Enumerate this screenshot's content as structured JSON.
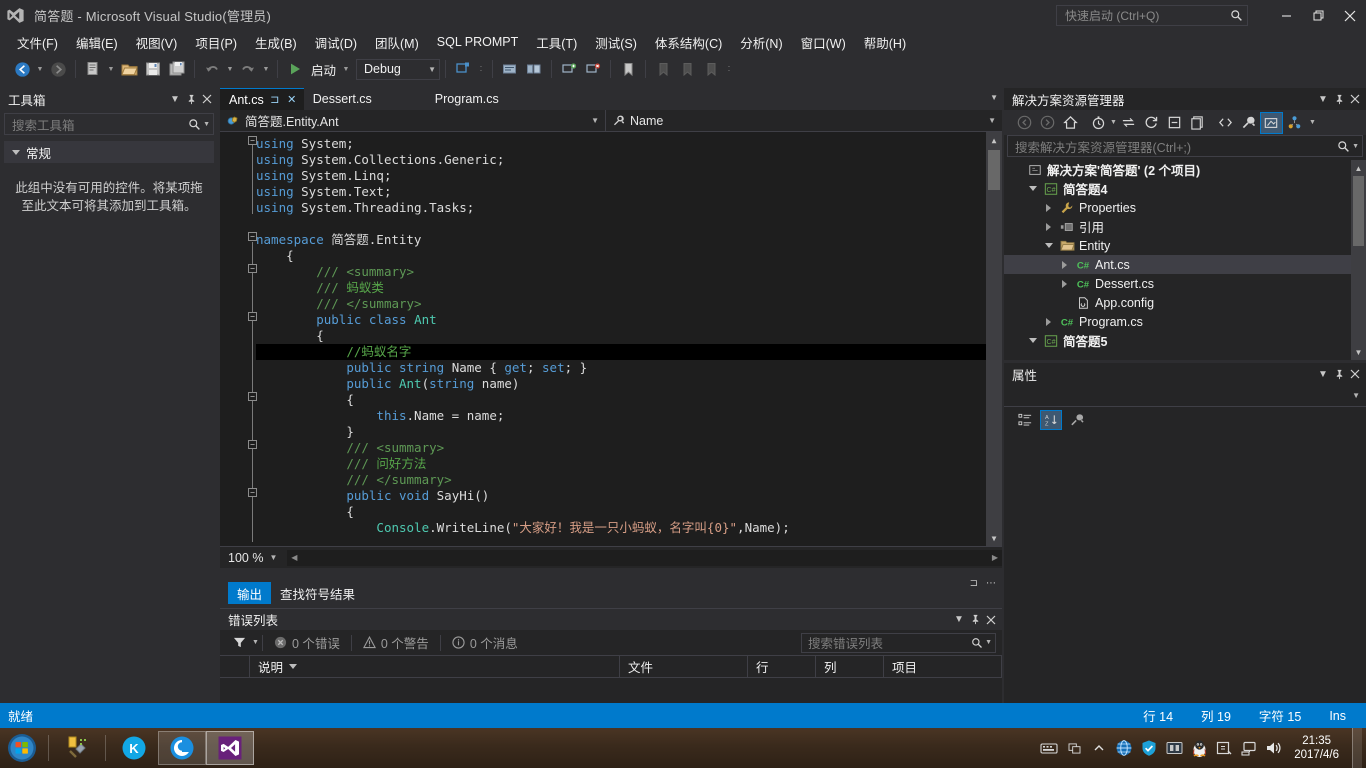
{
  "titlebar": {
    "title": "简答题 - Microsoft Visual Studio(管理员)",
    "quick_launch_placeholder": "快速启动 (Ctrl+Q)",
    "minimize": "—",
    "restore": "❐",
    "close": "✕"
  },
  "menu": {
    "items": [
      {
        "label": "文件(F)"
      },
      {
        "label": "编辑(E)"
      },
      {
        "label": "视图(V)"
      },
      {
        "label": "项目(P)"
      },
      {
        "label": "生成(B)"
      },
      {
        "label": "调试(D)"
      },
      {
        "label": "团队(M)"
      },
      {
        "label": "SQL PROMPT"
      },
      {
        "label": "工具(T)"
      },
      {
        "label": "测试(S)"
      },
      {
        "label": "体系结构(C)"
      },
      {
        "label": "分析(N)"
      },
      {
        "label": "窗口(W)"
      },
      {
        "label": "帮助(H)"
      }
    ]
  },
  "toolbar": {
    "start_label": "启动",
    "config_value": "Debug"
  },
  "toolbox": {
    "title": "工具箱",
    "search_placeholder": "搜索工具箱",
    "group_label": "常规",
    "empty_text": "此组中没有可用的控件。将某项拖至此文本可将其添加到工具箱。"
  },
  "editor": {
    "tabs": [
      {
        "label": "Ant.cs",
        "active": true
      },
      {
        "label": "Dessert.cs",
        "active": false
      },
      {
        "label": "Program.cs",
        "active": false
      }
    ],
    "nav_type": "简答题.Entity.Ant",
    "nav_member": "Name",
    "zoom": "100 %",
    "code_lines": [
      {
        "indent": 0,
        "fold": "minus",
        "tokens": [
          {
            "t": "using ",
            "c": "kw"
          },
          {
            "t": "System;",
            "c": "id"
          }
        ]
      },
      {
        "indent": 0,
        "fold": "",
        "tokens": [
          {
            "t": "using ",
            "c": "kw"
          },
          {
            "t": "System.Collections.Generic;",
            "c": "id"
          }
        ]
      },
      {
        "indent": 0,
        "fold": "",
        "tokens": [
          {
            "t": "using ",
            "c": "kw"
          },
          {
            "t": "System.Linq;",
            "c": "id"
          }
        ]
      },
      {
        "indent": 0,
        "fold": "",
        "tokens": [
          {
            "t": "using ",
            "c": "kw"
          },
          {
            "t": "System.Text;",
            "c": "id"
          }
        ]
      },
      {
        "indent": 0,
        "fold": "",
        "tokens": [
          {
            "t": "using ",
            "c": "kw"
          },
          {
            "t": "System.Threading.Tasks;",
            "c": "id"
          }
        ]
      },
      {
        "indent": 0,
        "fold": "",
        "tokens": []
      },
      {
        "indent": 0,
        "fold": "minus",
        "tokens": [
          {
            "t": "namespace ",
            "c": "kw"
          },
          {
            "t": "简答题.Entity",
            "c": "id"
          }
        ]
      },
      {
        "indent": 1,
        "fold": "",
        "tokens": [
          {
            "t": "{",
            "c": "pn"
          }
        ]
      },
      {
        "indent": 2,
        "fold": "minus",
        "tokens": [
          {
            "t": "/// ",
            "c": "xd"
          },
          {
            "t": "<summary>",
            "c": "xd"
          }
        ]
      },
      {
        "indent": 2,
        "fold": "",
        "tokens": [
          {
            "t": "/// ",
            "c": "xd"
          },
          {
            "t": "蚂蚁类",
            "c": "cm"
          }
        ]
      },
      {
        "indent": 2,
        "fold": "",
        "tokens": [
          {
            "t": "/// ",
            "c": "xd"
          },
          {
            "t": "</summary>",
            "c": "xd"
          }
        ]
      },
      {
        "indent": 2,
        "fold": "minus",
        "tokens": [
          {
            "t": "public ",
            "c": "kw"
          },
          {
            "t": "class ",
            "c": "kw"
          },
          {
            "t": "Ant",
            "c": "ty"
          }
        ]
      },
      {
        "indent": 2,
        "fold": "",
        "tokens": [
          {
            "t": "{",
            "c": "pn"
          }
        ]
      },
      {
        "indent": 3,
        "fold": "",
        "selected": true,
        "tokens": [
          {
            "t": "//蚂蚁名字",
            "c": "cm"
          }
        ]
      },
      {
        "indent": 3,
        "fold": "",
        "tokens": [
          {
            "t": "public ",
            "c": "kw"
          },
          {
            "t": "string ",
            "c": "kw"
          },
          {
            "t": "Name",
            "c": "id"
          },
          {
            "t": " { ",
            "c": "pn"
          },
          {
            "t": "get",
            "c": "kw"
          },
          {
            "t": "; ",
            "c": "pn"
          },
          {
            "t": "set",
            "c": "kw"
          },
          {
            "t": "; }",
            "c": "pn"
          }
        ]
      },
      {
        "indent": 3,
        "fold": "minus",
        "tokens": [
          {
            "t": "public ",
            "c": "kw"
          },
          {
            "t": "Ant",
            "c": "ty"
          },
          {
            "t": "(",
            "c": "pn"
          },
          {
            "t": "string ",
            "c": "kw"
          },
          {
            "t": "name",
            "c": "id"
          },
          {
            "t": ")",
            "c": "pn"
          }
        ]
      },
      {
        "indent": 3,
        "fold": "",
        "tokens": [
          {
            "t": "{",
            "c": "pn"
          }
        ]
      },
      {
        "indent": 4,
        "fold": "",
        "tokens": [
          {
            "t": "this",
            "c": "kw"
          },
          {
            "t": ".Name = name;",
            "c": "id"
          }
        ]
      },
      {
        "indent": 3,
        "fold": "",
        "tokens": [
          {
            "t": "}",
            "c": "pn"
          }
        ]
      },
      {
        "indent": 3,
        "fold": "minus",
        "tokens": [
          {
            "t": "/// ",
            "c": "xd"
          },
          {
            "t": "<summary>",
            "c": "xd"
          }
        ]
      },
      {
        "indent": 3,
        "fold": "",
        "tokens": [
          {
            "t": "/// ",
            "c": "xd"
          },
          {
            "t": "问好方法",
            "c": "cm"
          }
        ]
      },
      {
        "indent": 3,
        "fold": "",
        "tokens": [
          {
            "t": "/// ",
            "c": "xd"
          },
          {
            "t": "</summary>",
            "c": "xd"
          }
        ]
      },
      {
        "indent": 3,
        "fold": "minus",
        "tokens": [
          {
            "t": "public ",
            "c": "kw"
          },
          {
            "t": "void ",
            "c": "kw"
          },
          {
            "t": "SayHi",
            "c": "id"
          },
          {
            "t": "()",
            "c": "pn"
          }
        ]
      },
      {
        "indent": 3,
        "fold": "",
        "tokens": [
          {
            "t": "{",
            "c": "pn"
          }
        ]
      },
      {
        "indent": 4,
        "fold": "",
        "tokens": [
          {
            "t": "Console",
            "c": "ty"
          },
          {
            "t": ".WriteLine(",
            "c": "pn"
          },
          {
            "t": "\"大家好！我是一只小蚂蚁，名字叫{0}\"",
            "c": "st"
          },
          {
            "t": ",Name);",
            "c": "pn"
          }
        ]
      }
    ]
  },
  "output_tabs": [
    {
      "label": "输出",
      "active": true
    },
    {
      "label": "查找符号结果",
      "active": false
    }
  ],
  "error_list": {
    "title": "错误列表",
    "errors_label": "0 个错误",
    "warnings_label": "0 个警告",
    "messages_label": "0 个消息",
    "search_placeholder": "搜索错误列表",
    "columns": [
      "说明",
      "文件",
      "行",
      "列",
      "项目"
    ]
  },
  "solution_explorer": {
    "title": "解决方案资源管理器",
    "search_placeholder": "搜索解决方案资源管理器(Ctrl+;)",
    "tree": [
      {
        "label": "解决方案'简答题' (2 个项目)",
        "depth": 0,
        "twisty": "",
        "icon": "solution-icon",
        "selected": false,
        "bold": true
      },
      {
        "label": "简答题4",
        "depth": 1,
        "twisty": "down",
        "icon": "csharp-project-icon",
        "selected": false,
        "bold": true
      },
      {
        "label": "Properties",
        "depth": 2,
        "twisty": "right",
        "icon": "wrench-icon",
        "selected": false,
        "bold": false
      },
      {
        "label": "引用",
        "depth": 2,
        "twisty": "right",
        "icon": "references-icon",
        "selected": false,
        "bold": false
      },
      {
        "label": "Entity",
        "depth": 2,
        "twisty": "down",
        "icon": "folder-icon",
        "selected": false,
        "bold": false
      },
      {
        "label": "Ant.cs",
        "depth": 3,
        "twisty": "right",
        "icon": "csharp-file-icon",
        "selected": true,
        "bold": false
      },
      {
        "label": "Dessert.cs",
        "depth": 3,
        "twisty": "right",
        "icon": "csharp-file-icon",
        "selected": false,
        "bold": false
      },
      {
        "label": "App.config",
        "depth": 3,
        "twisty": "",
        "icon": "config-icon",
        "selected": false,
        "bold": false
      },
      {
        "label": "Program.cs",
        "depth": 2,
        "twisty": "right",
        "icon": "csharp-file-icon",
        "selected": false,
        "bold": false
      },
      {
        "label": "简答题5",
        "depth": 1,
        "twisty": "down",
        "icon": "csharp-project-icon",
        "selected": false,
        "bold": true
      }
    ]
  },
  "properties": {
    "title": "属性"
  },
  "statusbar": {
    "state": "就绪",
    "line_label": "行 14",
    "col_label": "列 19",
    "char_label": "字符 15",
    "ins_label": "Ins"
  },
  "taskbar": {
    "clock_time": "21:35",
    "clock_date": "2017/4/6"
  },
  "colors": {
    "accent": "#007acc",
    "chrome": "#2d2d30",
    "editor_bg": "#1e1e1e",
    "panel_bg": "#252526",
    "keyword": "#569cd6",
    "type": "#4ec9b0",
    "comment": "#57a64a",
    "string": "#d69d85"
  }
}
